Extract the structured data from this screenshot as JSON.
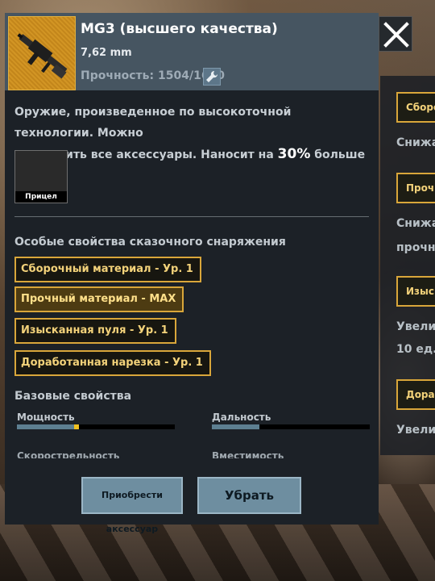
{
  "item": {
    "title": "MG3 (высшего качества)",
    "caliber": "7,62 mm",
    "durability": "Прочность: 1504/1600"
  },
  "description": {
    "line1": "Оружие, произведенное по высокоточной технологии. Можно",
    "line2_prefix": "установить все аксессуары. Наносит на ",
    "line2_highlight": "30%",
    "line2_suffix": " больше урона."
  },
  "attachment_slot": {
    "label": "Прицел"
  },
  "perks_section": {
    "title": "Особые свойства сказочного снаряжения",
    "perks": [
      "Сборочный материал - Ур. 1",
      "Прочный материал - MAX",
      "Изысканная пуля - Ур. 1",
      "Доработанная нарезка - Ур. 1"
    ]
  },
  "base_section": {
    "title": "Базовые свойства",
    "stats": [
      {
        "label": "Мощность",
        "value": 0.36,
        "boost": 0.03
      },
      {
        "label": "Дальность",
        "value": 0.3,
        "boost": 0
      }
    ],
    "clipped_labels": [
      "Скорострельность",
      "Вместимость"
    ]
  },
  "buttons": {
    "buy_accessory": "Приобрести аксессуар",
    "remove": "Убрать"
  },
  "side_panel": {
    "tags": [
      "Сборочн",
      "Прочны",
      "Изыск",
      "Доработ"
    ],
    "texts": [
      "Снижа",
      "Снижа",
      "прочно",
      "Увели",
      "10 ед.",
      "Увелич"
    ]
  },
  "colors": {
    "perk_border": "#d9a63a",
    "perk_text": "#f3d27a",
    "header_bg": "#465561",
    "panel_bg": "#1c2127",
    "button_bg": "#6e8ea0",
    "stat_fill": "#5d7f91",
    "stat_boost": "#f0c020"
  }
}
